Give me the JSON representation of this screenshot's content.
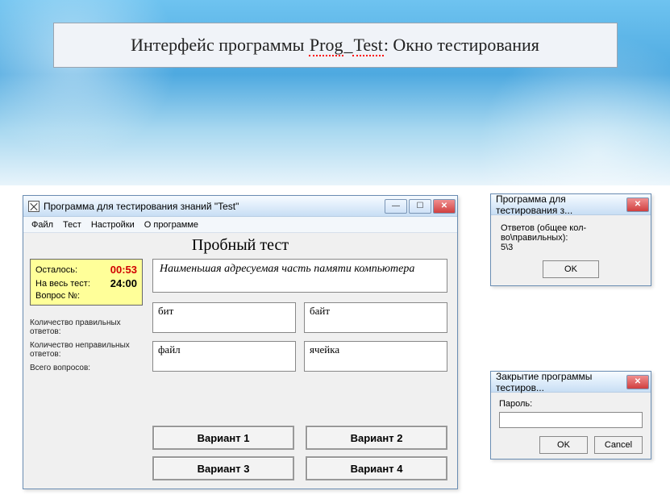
{
  "slide_title_parts": {
    "pre": "Интерфейс программы ",
    "prog": "Prog",
    "sep": "_",
    "test": "Test",
    "post": ": Окно тестирования"
  },
  "main_window": {
    "title": "Программа для тестирования знаний \"Test\"",
    "menu": {
      "file": "Файл",
      "test": "Тест",
      "settings": "Настройки",
      "about": "О программе"
    },
    "heading": "Пробный тест",
    "timer": {
      "left_label": "Осталось:",
      "left_value": "00:53",
      "total_label": "На весь тест:",
      "total_value": "24:00",
      "qnum_label": "Вопрос №:",
      "qnum_value": ""
    },
    "stats": {
      "correct_label": "Количество правильных ответов:",
      "correct_value": "",
      "wrong_label": "Количество неправильных ответов:",
      "wrong_value": "",
      "total_label": "Всего вопросов:",
      "total_value": ""
    },
    "question": "Наименьшая адресуемая часть памяти компьютера",
    "answers": [
      "бит",
      "байт",
      "файл",
      "ячейка"
    ],
    "variants": [
      "Вариант 1",
      "Вариант 2",
      "Вариант 3",
      "Вариант 4"
    ]
  },
  "results_dialog": {
    "title": "Программа для тестирования з...",
    "line1": "Ответов (общее кол-во\\правильных):",
    "line2": "5\\3",
    "ok": "OK"
  },
  "close_dialog": {
    "title": "Закрытие программы тестиров...",
    "pw_label": "Пароль:",
    "ok": "OK",
    "cancel": "Cancel"
  }
}
